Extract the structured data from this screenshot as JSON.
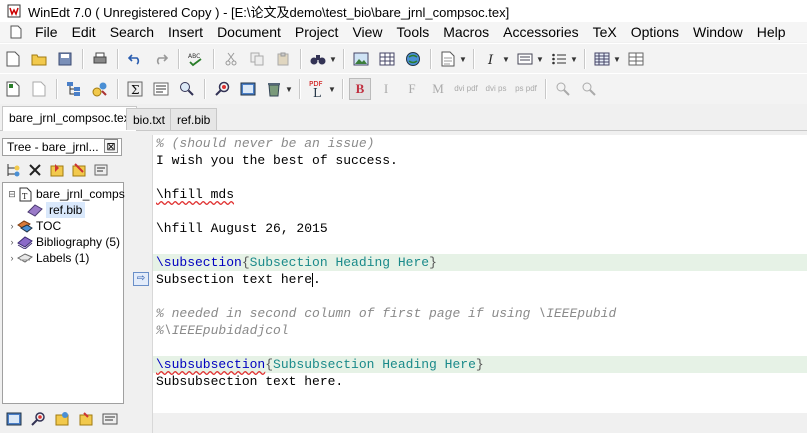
{
  "window": {
    "title": "WinEdt 7.0  ( Unregistered  Copy )  - [E:\\论文及demo\\test_bio\\bare_jrnl_compsoc.tex]"
  },
  "menu": [
    "File",
    "Edit",
    "Search",
    "Insert",
    "Document",
    "Project",
    "View",
    "Tools",
    "Macros",
    "Accessories",
    "TeX",
    "Options",
    "Window",
    "Help"
  ],
  "toolbar2_labels": {
    "pdf": "PDF",
    "bold": "B",
    "italic": "I",
    "f": "F",
    "m": "M",
    "dvi_pdf": "dvi pdf",
    "dvi_ps": "dvi ps",
    "ps_pdf": "ps pdf"
  },
  "tabs": [
    {
      "label": "bare_jrnl_compsoc.tex",
      "active": true
    },
    {
      "label": "bio.txt",
      "active": false
    },
    {
      "label": "ref.bib",
      "active": false
    }
  ],
  "tree": {
    "header": "Tree - bare_jrnl...",
    "close": "⊠",
    "items": [
      {
        "label": "bare_jrnl_comps",
        "icon": "tex-file-icon",
        "expander": "⊟"
      },
      {
        "label": "ref.bib",
        "icon": "bib-file-icon",
        "expander": ""
      },
      {
        "label": "TOC",
        "icon": "toc-icon",
        "expander": "›"
      },
      {
        "label": "Bibliography  (5)",
        "icon": "bibliography-icon",
        "expander": "›"
      },
      {
        "label": "Labels  (1)",
        "icon": "labels-icon",
        "expander": "›"
      }
    ]
  },
  "editor": {
    "gutter_marker": "⇨",
    "lines": {
      "l1": "% (should never be an issue)",
      "l2": "I wish you the best of success.",
      "l4": "\\hfill mds",
      "l6": "\\hfill August 26, 2015",
      "l8_cmd": "\\subsection",
      "l8_open": "{",
      "l8_text": "Subsection Heading Here",
      "l8_close": "}",
      "l9": "Subsection text here",
      "l9_end": ".",
      "l11": "% needed in second column of first page if using \\IEEEpubid",
      "l12": "%\\IEEEpubidadjcol",
      "l14_cmd": "\\subsubsection",
      "l14_open": "{",
      "l14_text": "Subsubsection Heading Here",
      "l14_close": "}",
      "l15": "Subsubsection text here."
    }
  },
  "colors": {
    "highlight_line": "#e6f2e6",
    "command": "#0000c0",
    "heading": "#1a8a8a",
    "comment": "#8a8a8a"
  }
}
